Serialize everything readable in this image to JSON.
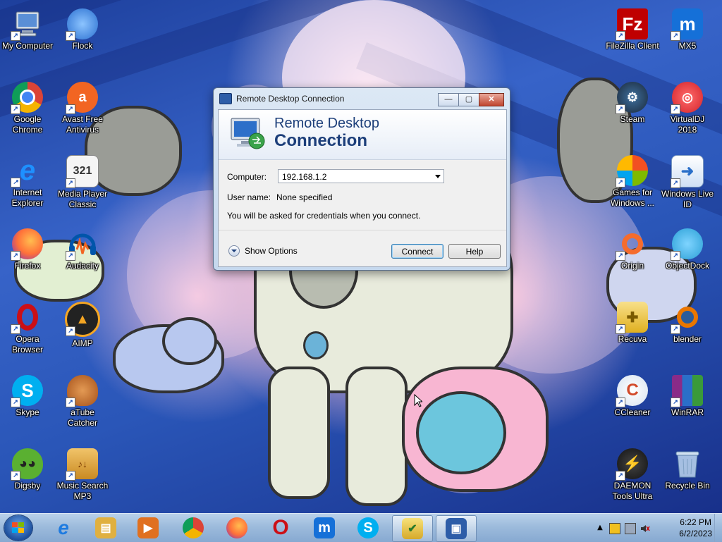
{
  "desktop": {
    "icons_left": [
      {
        "label": "My Computer",
        "icon": "computer-icon",
        "color": "#5a7fb8"
      },
      {
        "label": "Flock",
        "icon": "flock-icon",
        "color": "#3a7bd5"
      },
      {
        "label": "Google Chrome",
        "icon": "chrome-icon",
        "color": "#db4437"
      },
      {
        "label": "Avast Free Antivirus",
        "icon": "avast-icon",
        "color": "#f26522"
      },
      {
        "label": "Internet Explorer",
        "icon": "internet-explorer-icon",
        "color": "#1e90ff"
      },
      {
        "label": "Media Player Classic",
        "icon": "media-player-classic-icon",
        "color": "#444444"
      },
      {
        "label": "Firefox",
        "icon": "firefox-icon",
        "color": "#ff7139"
      },
      {
        "label": "Audacity",
        "icon": "audacity-icon",
        "color": "#0055aa"
      },
      {
        "label": "Opera Browser",
        "icon": "opera-icon",
        "color": "#cc0f16"
      },
      {
        "label": "AIMP",
        "icon": "aimp-icon",
        "color": "#f5a623"
      },
      {
        "label": "Skype",
        "icon": "skype-icon",
        "color": "#00aff0"
      },
      {
        "label": "aTube Catcher",
        "icon": "atube-catcher-icon",
        "color": "#c0651e"
      },
      {
        "label": "Digsby",
        "icon": "digsby-icon",
        "color": "#5ab031"
      },
      {
        "label": "Music Search MP3",
        "icon": "music-search-icon",
        "color": "#e0a030"
      }
    ],
    "icons_right": [
      {
        "label": "FileZilla Client",
        "icon": "filezilla-icon",
        "color": "#bf0000"
      },
      {
        "label": "MX5",
        "icon": "maxthon-icon",
        "color": "#1570d8"
      },
      {
        "label": "Steam",
        "icon": "steam-icon",
        "color": "#1b2838"
      },
      {
        "label": "VirtualDJ 2018",
        "icon": "virtualdj-icon",
        "color": "#d3222a"
      },
      {
        "label": "Games for Windows ...",
        "icon": "games-for-windows-icon",
        "color": "#2d6a2d"
      },
      {
        "label": "Windows Live ID",
        "icon": "windows-live-id-icon",
        "color": "#2a6fc9"
      },
      {
        "label": "Origin",
        "icon": "origin-icon",
        "color": "#f56c2d"
      },
      {
        "label": "ObjectDock",
        "icon": "objectdock-icon",
        "color": "#2a9fd6"
      },
      {
        "label": "Recuva",
        "icon": "recuva-icon",
        "color": "#e0b020"
      },
      {
        "label": "blender",
        "icon": "blender-icon",
        "color": "#ea7600"
      },
      {
        "label": "CCleaner",
        "icon": "ccleaner-icon",
        "color": "#d24a2a"
      },
      {
        "label": "WinRAR",
        "icon": "winrar-icon",
        "color": "#8a2b88"
      },
      {
        "label": "DAEMON Tools Ultra",
        "icon": "daemon-tools-icon",
        "color": "#e09a20"
      },
      {
        "label": "Recycle Bin",
        "icon": "recycle-bin-icon",
        "color": "#7fb0d8"
      }
    ]
  },
  "dialog": {
    "title": "Remote Desktop Connection",
    "banner_line1": "Remote Desktop",
    "banner_line2": "Connection",
    "computer_label": "Computer:",
    "computer_value": "192.168.1.2",
    "username_label": "User name:",
    "username_value": "None specified",
    "info": "You will be asked for credentials when you connect.",
    "show_options": "Show Options",
    "connect": "Connect",
    "help": "Help",
    "minimize": "—",
    "maximize": "▢",
    "close": "✕"
  },
  "taskbar": {
    "pinned": [
      {
        "name": "internet-explorer",
        "glyph": "e",
        "color": "#1e7be0"
      },
      {
        "name": "file-explorer",
        "glyph": "▤",
        "color": "#e0b040"
      },
      {
        "name": "media-player",
        "glyph": "▶",
        "color": "#e07020"
      },
      {
        "name": "chrome",
        "glyph": "◉",
        "color": "#db4437"
      },
      {
        "name": "firefox",
        "glyph": "◕",
        "color": "#ff7139"
      },
      {
        "name": "opera",
        "glyph": "O",
        "color": "#cc0f16"
      },
      {
        "name": "maxthon",
        "glyph": "m",
        "color": "#1570d8"
      },
      {
        "name": "skype",
        "glyph": "S",
        "color": "#00aff0"
      },
      {
        "name": "task-checker",
        "glyph": "✔",
        "color": "#3a9a3a"
      },
      {
        "name": "remote-desktop",
        "glyph": "▣",
        "color": "#2d5da8"
      }
    ],
    "time": "6:22 PM",
    "date": "6/2/2023"
  }
}
